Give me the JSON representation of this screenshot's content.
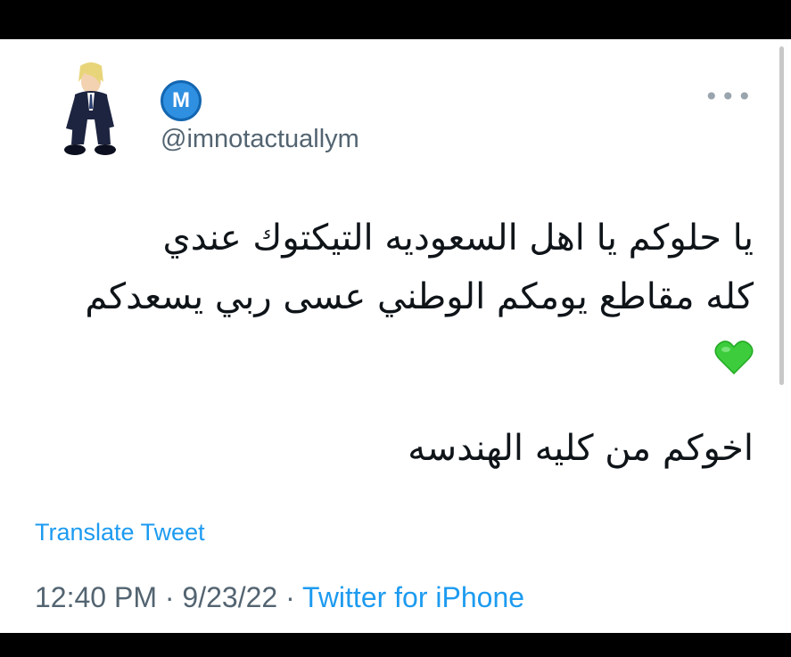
{
  "user": {
    "badge_letter": "M",
    "handle": "@imnotactuallym"
  },
  "menu": {
    "more_label": "•••"
  },
  "tweet": {
    "line1": "يا حلوكم يا اهل السعوديه التيكتوك عندي",
    "line2": "كله مقاطع يومكم الوطني عسى ربي يسعدكم",
    "emoji": "green-heart",
    "line3": "اخوكم من كليه الهندسه"
  },
  "translate_label": "Translate Tweet",
  "meta": {
    "time": "12:40 PM",
    "sep1": " · ",
    "date": "9/23/22",
    "sep2": " · ",
    "source": "Twitter for iPhone"
  },
  "colors": {
    "accent": "#1d9bf0",
    "secondary_text": "#536471",
    "badge": "#2f8fe0",
    "heart": "#3ccc3c"
  }
}
